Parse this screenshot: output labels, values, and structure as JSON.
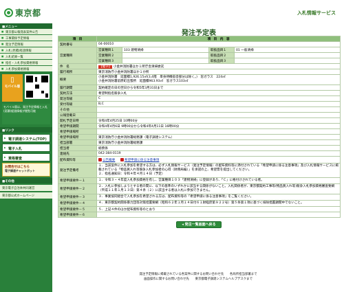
{
  "header": {
    "logo_text": "東京都",
    "service_title": "入札情報サービス"
  },
  "sidebar": {
    "section_main": "■メニュー",
    "links": [
      "東京都公報発表案件公告",
      "工事関係予定情報",
      "発注予定情報",
      "入札(見積)経過情報",
      "入札結果一覧",
      "指名・入札参加資格情報",
      "入札参加資格情報"
    ],
    "mobile_card": "モバイル版",
    "mobile_note": "モバイル版は、発注予定情報と入札(見積)経過情報が閲覧可能",
    "section_links": "■リンク",
    "buttons": [
      "電子調達システム(TOP)",
      "電子入札",
      "資格審査"
    ],
    "help_card_line1": "お問合せはこちら",
    "help_card_line2": "電子調達チャットボット",
    "section_other": "■その他",
    "bottom_links": [
      "東京電子自治体共同運営",
      "東京都公式ホームページ"
    ]
  },
  "main": {
    "page_title": "発注予定表",
    "table_header": {
      "item": "項　目",
      "content": "項　目　内　容"
    },
    "contract_no_label": "契約番号",
    "contract_no": "04-00010",
    "business_type_label": "営業種目",
    "business_rows": [
      {
        "label": "営業種目１",
        "value": "103 建物清掃",
        "label2": "取扱品目１",
        "value2": "01 一般清掃"
      },
      {
        "label": "営業種目２",
        "value": "",
        "label2": "取扱品目２",
        "value2": ""
      },
      {
        "label": "営業種目３",
        "value": "",
        "label2": "取扱品目３",
        "value2": ""
      }
    ],
    "subject_label": "件　名",
    "subject_tag": "【電子】",
    "subject": "小金井消防署ほか１所庁舎清掃委託",
    "location_label": "履行場所",
    "location": "東京消防庁小金井消防署ほか１か所",
    "summary_label": "概要",
    "summary_line1": "小金井消防署　延面積1,926.15㎡(3,4階　単身待機宿舎部分は除く。)　窓ガラス　224㎡",
    "summary_line2": "小金井消防署前原町出張所　延面積963.93㎡　窓ガラス103㎡",
    "period_label": "履行期間",
    "period": "契約確定の日の翌日から令和5年3月31日まで",
    "method_label": "契約方法",
    "method": "希望制指名競争入札",
    "category_label": "発注等級",
    "category": "C",
    "acceptance_label": "受付等級",
    "acceptance": "B,C",
    "other_label": "その他",
    "other": "",
    "announce_label": "公報登載日",
    "announce": "",
    "open_label": "開札予定日時",
    "open": "令和4年4月25日 10時00分",
    "period_apply_label": "希望申請期間",
    "period_apply": "令和4年4月6日 9時00分から令和4年4月11日 16時00分",
    "place_label": "希望申請場所",
    "place": "",
    "dept_label": "希望申請場所",
    "dept": "東京消防庁小金井消防署総務課（電子調達システム）",
    "contract_dept_label": "担当部署",
    "contract_dept": "東京消防庁小金井消防署総務課",
    "staff_label": "担当者",
    "staff": "総務係",
    "tel_label": "連絡先",
    "tel": "042-384-0119",
    "docs_label": "配布資料等",
    "docs": [
      "公告概要",
      "希望申請に係る注意事項"
    ],
    "condition_label": "発注予定備考",
    "condition_lines": [
      "１．当該案件に入札参加を希望する方は、必ず入札情報サービス（発注予定情報）の配布資料等に添付されている「希望申請に係る注意事項」及び入札情報サービスに掲載されている「物品買入れ等競争入札参加者の心得（財務局編）」を承諾の上、希望票を提出してください。",
      "２．指名通知日：令和４年４月１４日（予定）"
    ],
    "req_rows": [
      {
        "label": "希望申請要件－１",
        "text": "１．令和３・４年度入札参加資格を有し、営業種目１０３「建物清掃」に登録があり、「Ｃ」に格付けされている者。"
      },
      {
        "label": "希望申請要件－２",
        "text": "２．入札に参加しようとする者の間に、以下の基準のいずれかに該当する関係がないこと。入札関係者が、東京都契約工事等(物品買入れ等)競争入札参加資格審査要綱（平成１１年１月１３日）第４条（２）に該当する者は入札に参加できません。"
      },
      {
        "label": "希望申請要件－３",
        "text": "３．事業協同組合で入札参加を希望される方は、配布資料等の「希望申請に係る注意事項」をご覧ください。"
      },
      {
        "label": "希望申請要件－４",
        "text": "４．東京都契約関係暴力団等対策措置要綱（昭和６２年１月１４日付６１財経庶第９２２号）第５条第１項に基づく排除措置期間中でないこと。"
      },
      {
        "label": "希望申請要件－５",
        "text": "５．上記４件のほか配布資料等のとおり"
      },
      {
        "label": "希望申請要件－６",
        "text": ""
      }
    ],
    "back_button": "発注一覧画面へ戻る"
  },
  "footer": {
    "line1": "発注予定情報に掲載されている各案件に関するお問い合わせ先　　各局所担当部署まで",
    "line2": "画面操作に関するお問い合わせ先　　東京都電子調達システムヘルプデスクまで"
  },
  "colors": {
    "sidebar": "#29803a",
    "table_bg": "#e8f2dc",
    "label_bg": "#c9e0b6",
    "accent_red": "#d83020"
  }
}
